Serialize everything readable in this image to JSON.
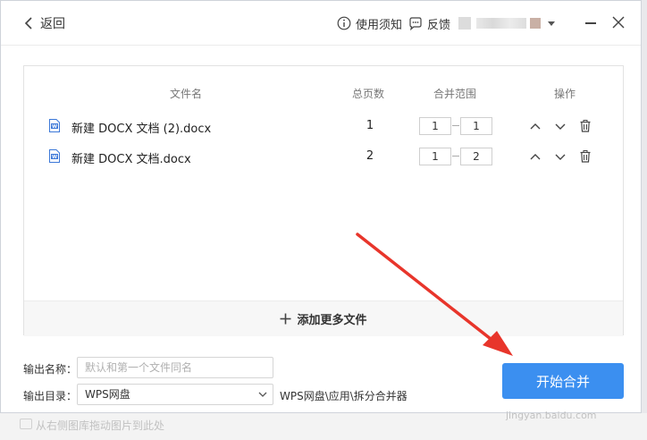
{
  "header": {
    "back_label": "返回",
    "notice_label": "使用须知",
    "feedback_label": "反馈"
  },
  "table": {
    "columns": [
      "文件名",
      "总页数",
      "合并范围",
      "操作"
    ],
    "rows": [
      {
        "name": "新建 DOCX 文档 (2).docx",
        "pages": "1",
        "from": "1",
        "to": "1"
      },
      {
        "name": "新建 DOCX 文档.docx",
        "pages": "2",
        "from": "1",
        "to": "2"
      }
    ],
    "add_more_label": "添加更多文件"
  },
  "output": {
    "name_label": "输出名称：",
    "name_placeholder": "默认和第一个文件同名",
    "dir_label": "输出目录：",
    "dir_value": "WPS网盘",
    "dir_path": "WPS网盘\\应用\\拆分合并器"
  },
  "actions": {
    "start_label": "开始合并"
  },
  "background": {
    "hint_text": "从右侧图库拖动图片到此处"
  },
  "watermark": "jingyan.baidu.com",
  "colors": {
    "primary": "#3b8ff0",
    "annotation_arrow": "#e8352b",
    "doc_icon": "#3c78d8"
  }
}
